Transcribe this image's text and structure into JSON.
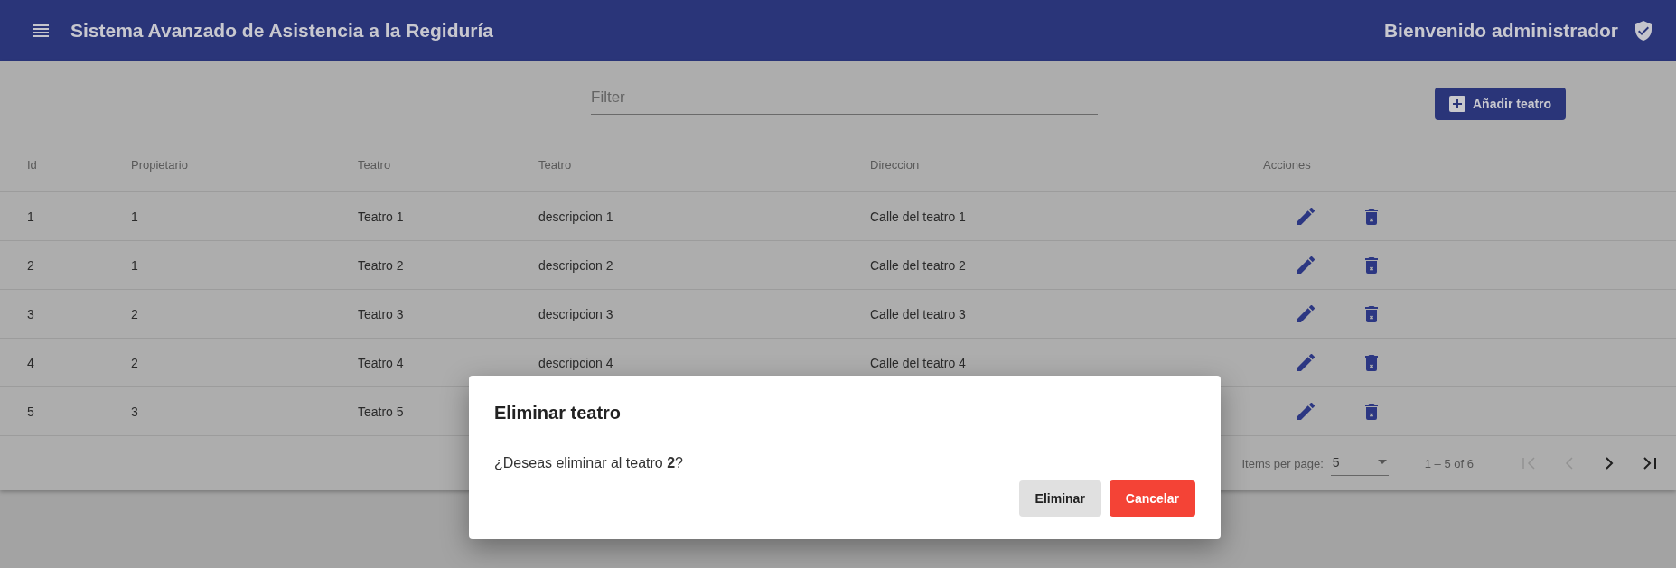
{
  "toolbar": {
    "title": "Sistema Avanzado de Asistencia a la Regiduría",
    "welcome": "Bienvenido administrador"
  },
  "filter": {
    "placeholder": "Filter"
  },
  "add_button": {
    "label": "Añadir teatro"
  },
  "table": {
    "columns": [
      "Id",
      "Propietario",
      "Teatro",
      "Teatro",
      "Direccion",
      "Acciones"
    ],
    "rows": [
      {
        "id": "1",
        "owner": "1",
        "name": "Teatro 1",
        "description": "descripcion 1",
        "address": "Calle del teatro 1"
      },
      {
        "id": "2",
        "owner": "1",
        "name": "Teatro 2",
        "description": "descripcion 2",
        "address": "Calle del teatro 2"
      },
      {
        "id": "3",
        "owner": "2",
        "name": "Teatro 3",
        "description": "descripcion 3",
        "address": "Calle del teatro 3"
      },
      {
        "id": "4",
        "owner": "2",
        "name": "Teatro 4",
        "description": "descripcion 4",
        "address": "Calle del teatro 4"
      },
      {
        "id": "5",
        "owner": "3",
        "name": "Teatro 5"
      }
    ]
  },
  "paginator": {
    "items_label": "Items per page:",
    "page_size": "5",
    "range": "1 – 5 of 6",
    "nav": [
      {
        "kind": "first",
        "disabled": true
      },
      {
        "kind": "previous",
        "disabled": true
      },
      {
        "kind": "next",
        "disabled": false
      },
      {
        "kind": "last",
        "disabled": false
      }
    ]
  },
  "dialog": {
    "title": "Eliminar teatro",
    "message": "¿Deseas eliminar al teatro **2**?",
    "buttons": [
      {
        "label": "Eliminar",
        "kind": "plain"
      },
      {
        "label": "Cancelar",
        "kind": "warn"
      }
    ]
  }
}
